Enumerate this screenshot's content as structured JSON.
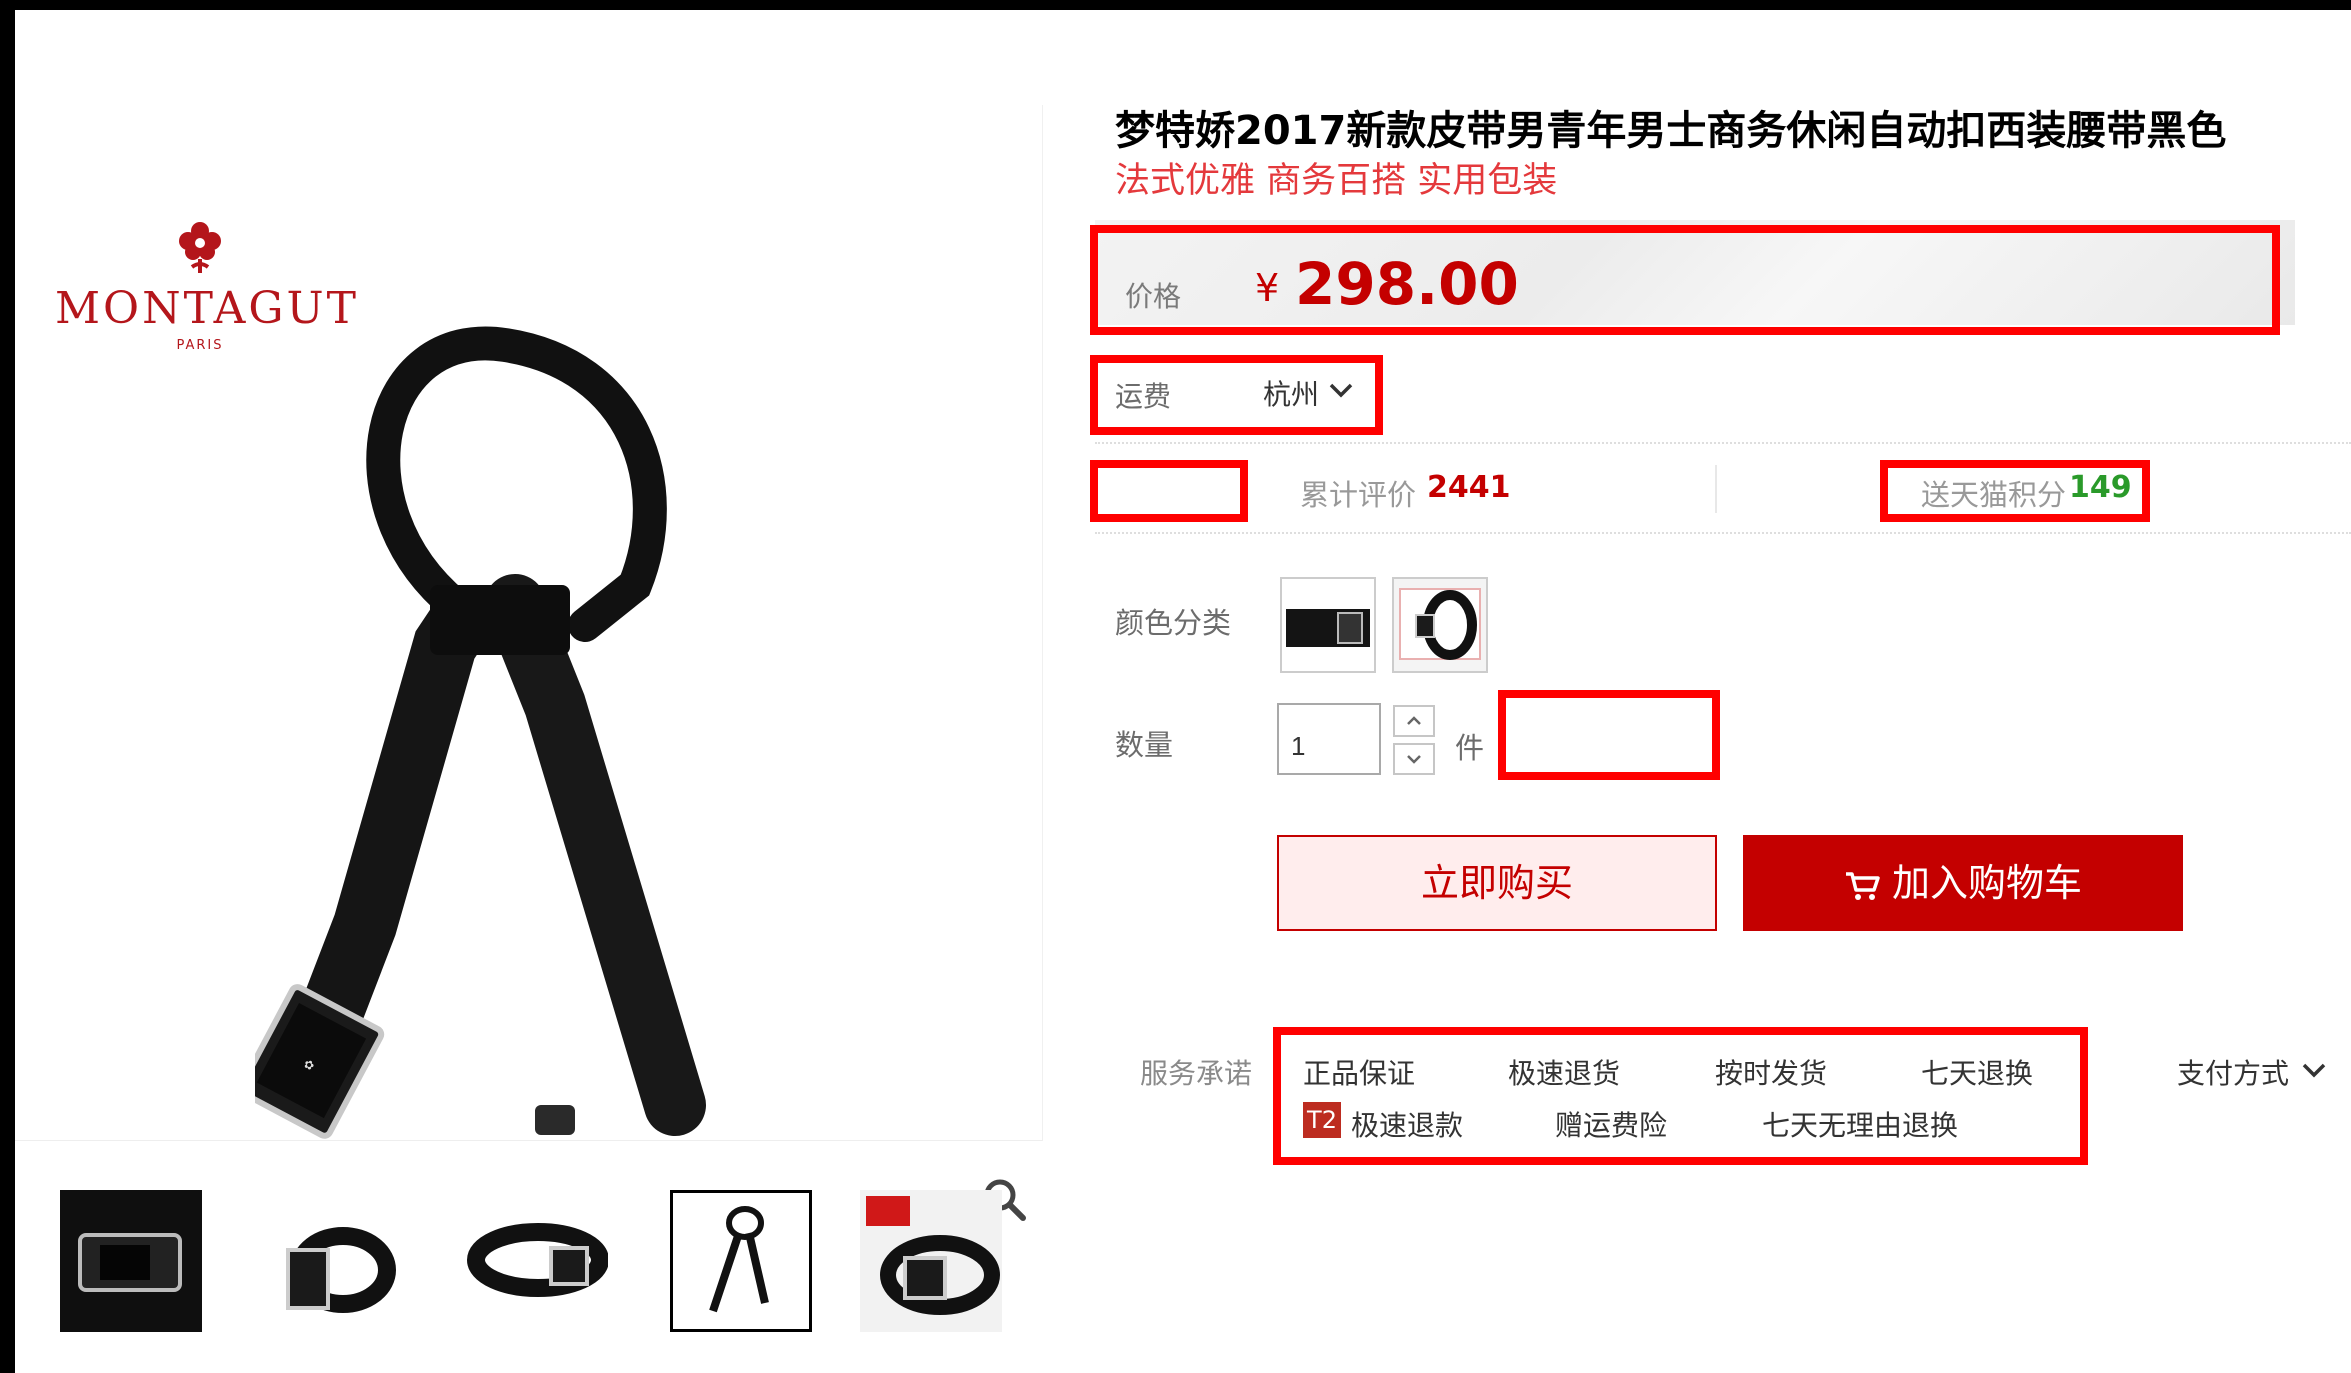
{
  "brand": {
    "name": "MONTAGUT",
    "sub": "PARIS"
  },
  "product": {
    "title": "梦特娇2017新款皮带男青年男士商务休闲自动扣西装腰带黑色",
    "subtitle": "法式优雅 商务百搭 实用包装"
  },
  "price": {
    "label": "价格",
    "currency": "¥",
    "value": "298.00"
  },
  "shipping": {
    "label": "运费",
    "city": "杭州"
  },
  "stats": {
    "review_label": "累计评价",
    "review_count": "2441",
    "points_label": "送天猫积分",
    "points_value": "149"
  },
  "options": {
    "color_label": "颜色分类",
    "qty_label": "数量",
    "qty_value": "1",
    "unit": "件"
  },
  "actions": {
    "buy_now": "立即购买",
    "add_cart": "加入购物车"
  },
  "service": {
    "label": "服务承诺",
    "row1": [
      "正品保证",
      "极速退货",
      "按时发货",
      "七天退换"
    ],
    "badge": "T2",
    "row2": [
      "极速退款",
      "赠运费险",
      "七天无理由退换"
    ],
    "payment": "支付方式"
  },
  "icons": {
    "zoom": "magnifier-icon",
    "cart": "shopping-cart-icon",
    "chevron": "chevron-down-icon",
    "qty_up": "chevron-up-icon",
    "qty_down": "chevron-down-icon"
  },
  "colors": {
    "accent": "#c40000",
    "highlight": "#ff0000",
    "points": "#2a9a2a",
    "subtitle": "#e4393c"
  }
}
